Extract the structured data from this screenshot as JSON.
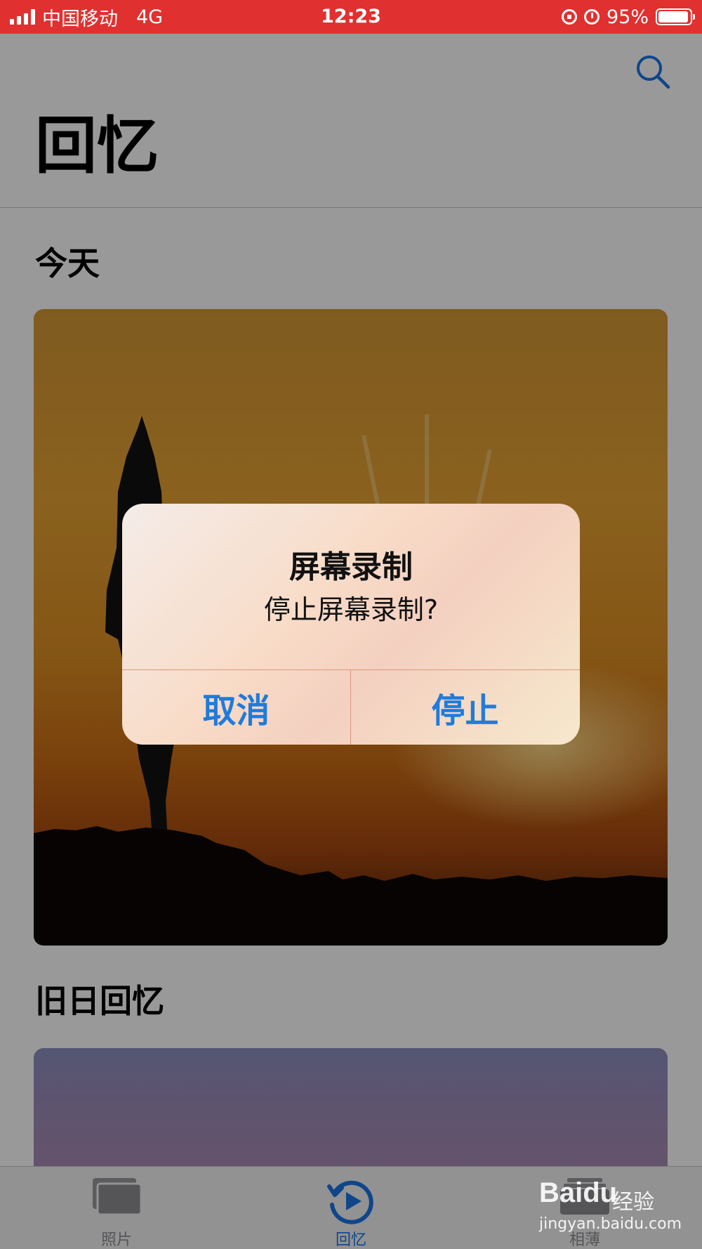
{
  "status_bar": {
    "carrier": "中国移动",
    "network": "4G",
    "time": "12:23",
    "battery_percent": "95%",
    "battery_level": 0.95
  },
  "header": {
    "search_icon": "search-icon",
    "title": "回忆"
  },
  "sections": {
    "today": "今天",
    "past_memories": "旧日回忆"
  },
  "tabs": [
    {
      "label": "照片",
      "icon": "photos-icon",
      "active": false
    },
    {
      "label": "回忆",
      "icon": "memories-icon",
      "active": true
    },
    {
      "label": "相薄",
      "icon": "albums-icon",
      "active": false
    }
  ],
  "alert": {
    "title": "屏幕录制",
    "message": "停止屏幕录制?",
    "cancel_label": "取消",
    "stop_label": "停止"
  },
  "watermark": {
    "logo": "Baidu",
    "text": "经验",
    "url": "jingyan.baidu.com"
  },
  "colors": {
    "status_bar": "#e0302f",
    "accent": "#1a76e6",
    "alert_button": "#1f7bdc"
  }
}
